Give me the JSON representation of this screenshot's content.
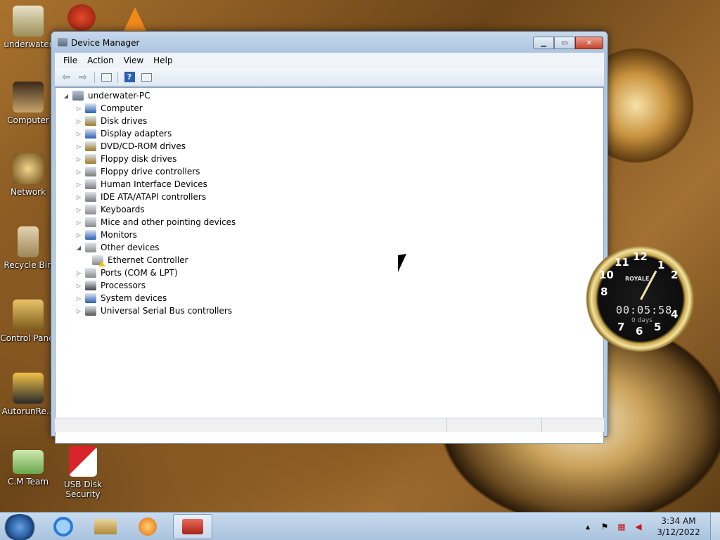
{
  "desktop": {
    "icons": [
      {
        "label": "underwater"
      },
      {
        "label": "Computer"
      },
      {
        "label": "Network"
      },
      {
        "label": "Recycle Bin"
      },
      {
        "label": "Control Panel"
      },
      {
        "label": "AutorunRe..."
      },
      {
        "label": "C.M Team"
      },
      {
        "label": "USB Disk Security"
      }
    ]
  },
  "window": {
    "title": "Device Manager",
    "menu": [
      "File",
      "Action",
      "View",
      "Help"
    ],
    "toolbar_icons": [
      "back-icon",
      "forward-icon",
      "properties-icon",
      "help-icon",
      "show-hidden-icon"
    ],
    "root": "underwater-PC",
    "items": [
      {
        "label": "Computer",
        "icon": "computer-icon",
        "color": "#2b5fb5"
      },
      {
        "label": "Disk drives",
        "icon": "disk-icon",
        "color": "#9b7a2b"
      },
      {
        "label": "Display adapters",
        "icon": "display-icon",
        "color": "#2b5fb5"
      },
      {
        "label": "DVD/CD-ROM drives",
        "icon": "dvd-icon",
        "color": "#9b7a2b"
      },
      {
        "label": "Floppy disk drives",
        "icon": "floppy-icon",
        "color": "#9b7a2b"
      },
      {
        "label": "Floppy drive controllers",
        "icon": "controller-icon",
        "color": "#7a7a7a"
      },
      {
        "label": "Human Interface Devices",
        "icon": "hid-icon",
        "color": "#7a7a7a"
      },
      {
        "label": "IDE ATA/ATAPI controllers",
        "icon": "ide-icon",
        "color": "#7a7a7a"
      },
      {
        "label": "Keyboards",
        "icon": "keyboard-icon",
        "color": "#8a8a8a"
      },
      {
        "label": "Mice and other pointing devices",
        "icon": "mouse-icon",
        "color": "#8a8a8a"
      },
      {
        "label": "Monitors",
        "icon": "monitor-icon",
        "color": "#2b5fb5"
      },
      {
        "label": "Other devices",
        "icon": "unknown-device-icon",
        "color": "#8a8a8a"
      },
      {
        "label": "Ethernet Controller",
        "icon": "warning-device-icon",
        "color": "#8a8a8a"
      },
      {
        "label": "Ports (COM & LPT)",
        "icon": "port-icon",
        "color": "#8a8a8a"
      },
      {
        "label": "Processors",
        "icon": "processor-icon",
        "color": "#444444"
      },
      {
        "label": "System devices",
        "icon": "system-icon",
        "color": "#2b5fb5"
      },
      {
        "label": "Universal Serial Bus controllers",
        "icon": "usb-icon",
        "color": "#555555"
      }
    ]
  },
  "clock_gadget": {
    "brand": "ROYALE",
    "digital": "00:05:58",
    "days": "0 days",
    "numbers": [
      "12",
      "1",
      "2",
      "4",
      "5",
      "6",
      "7",
      "8",
      "10",
      "11"
    ]
  },
  "taskbar": {
    "time": "3:34 AM",
    "date": "3/12/2022"
  }
}
